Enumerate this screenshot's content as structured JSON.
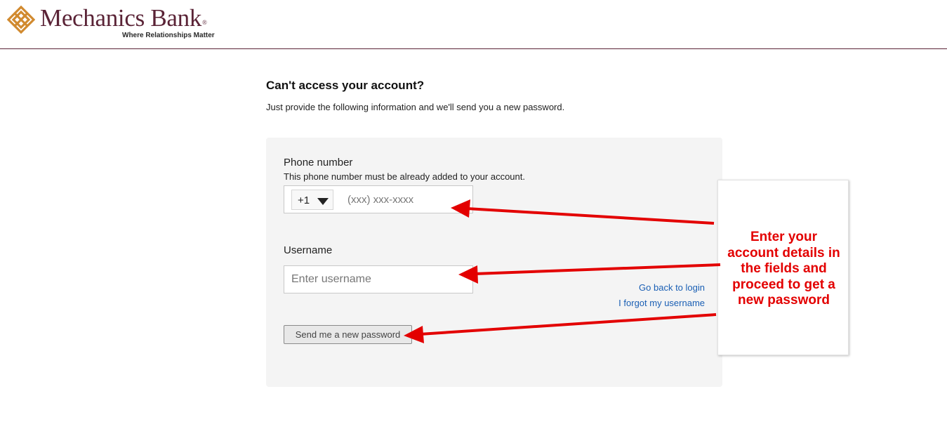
{
  "brand": {
    "name": "Mechanics Bank",
    "registered_mark": "®",
    "tagline": "Where Relationships Matter",
    "logo_icon": "diamond-lattice-icon",
    "logo_color": "#d18a2f",
    "brand_color": "#5a2336"
  },
  "page": {
    "title": "Can't access your account?",
    "subtitle": "Just provide the following information and we'll send you a new password."
  },
  "form": {
    "phone": {
      "label": "Phone number",
      "help": "This phone number must be already added to your account.",
      "country_code": "+1",
      "placeholder": "(xxx) xxx-xxxx",
      "value": ""
    },
    "username": {
      "label": "Username",
      "placeholder": "Enter username",
      "value": ""
    },
    "links": {
      "back_to_login": "Go back to login",
      "forgot_username": "I forgot my username"
    },
    "submit_label": "Send me a new password"
  },
  "annotation": {
    "callout_lines": [
      "Enter your",
      "account details in",
      "the fields and",
      "proceed to get a",
      "new password"
    ],
    "color": "#e30000"
  }
}
